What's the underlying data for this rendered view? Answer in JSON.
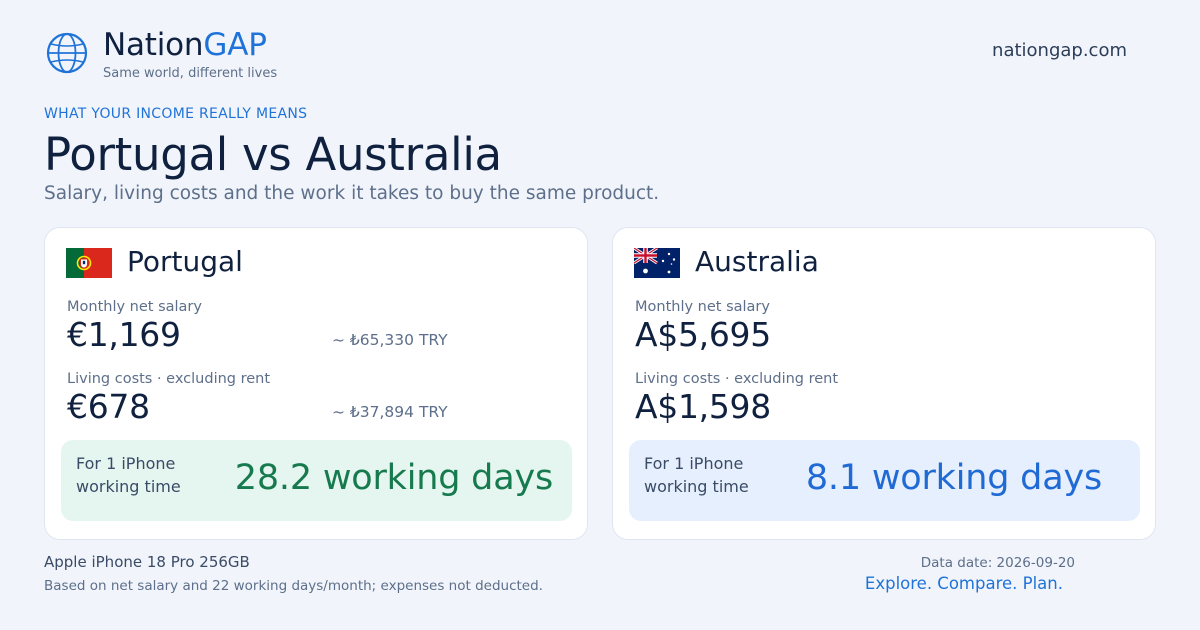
{
  "header": {
    "brand_part1": "Nation",
    "brand_part2": "GAP",
    "tagline": "Same world, different lives",
    "domain": "nationgap.com",
    "logo_icon": "globe-icon"
  },
  "hero": {
    "eyebrow": "WHAT YOUR INCOME REALLY MEANS",
    "title": "Portugal vs Australia",
    "subtitle": "Salary, living costs and the work it takes to buy the same product."
  },
  "cards": [
    {
      "country": "Portugal",
      "flag_icon": "portugal-flag-icon",
      "salary_label": "Monthly net salary",
      "salary": "€1,169",
      "salary_converted": "~ ₺65,330 TRY",
      "costs_label": "Living costs · excluding rent",
      "costs": "€678",
      "costs_converted": "~ ₺37,894 TRY",
      "work_label_line1": "For 1 iPhone",
      "work_label_line2": "working time",
      "work_value": "28.2 working days",
      "accent": "#177a4f"
    },
    {
      "country": "Australia",
      "flag_icon": "australia-flag-icon",
      "salary_label": "Monthly net salary",
      "salary": "A$5,695",
      "costs_label": "Living costs · excluding rent",
      "costs": "A$1,598",
      "work_label_line1": "For 1 iPhone",
      "work_label_line2": "working time",
      "work_value": "8.1 working days",
      "accent": "#1f6ad4"
    }
  ],
  "footer": {
    "product": "Apple iPhone 18 Pro 256GB",
    "note": "Based on net salary and 22 working days/month; expenses not deducted.",
    "data_date": "Data date: 2026-09-20",
    "cta": "Explore. Compare. Plan."
  },
  "colors": {
    "background": "#f1f5fb",
    "brand_blue": "#1f73d8",
    "green_panel": "#e5f5ef",
    "blue_panel": "#e6effd"
  }
}
